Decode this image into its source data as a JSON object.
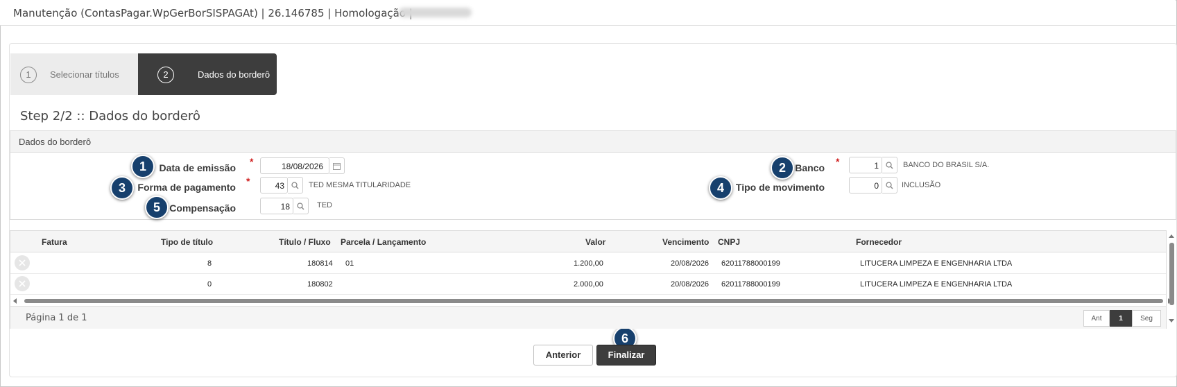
{
  "window": {
    "title": "Manutenção (ContasPagar.WpGerBorSISPAGAt) | 26.146785 | Homologação |"
  },
  "wizard": {
    "steps": [
      {
        "num": "1",
        "label": "Selecionar títulos"
      },
      {
        "num": "2",
        "label": "Dados do borderô"
      }
    ]
  },
  "step_title": "Step 2/2 :: Dados do borderô",
  "section": {
    "title": "Dados do borderô"
  },
  "form": {
    "data_emissao": {
      "label": "Data de emissão",
      "required": "*",
      "value": "18/08/2026"
    },
    "forma_pagamento": {
      "label": "Forma de pagamento",
      "required": "*",
      "value": "43",
      "desc": "TED MESMA TITULARIDADE"
    },
    "compensacao": {
      "label": "Compensação",
      "value": "18",
      "desc": "TED"
    },
    "banco": {
      "label": "Banco",
      "required": "*",
      "value": "1",
      "desc": "BANCO DO BRASIL S/A."
    },
    "tipo_movimento": {
      "label": "Tipo de movimento",
      "value": "0",
      "desc": "INCLUSÃO"
    }
  },
  "badges": [
    "1",
    "2",
    "3",
    "4",
    "5",
    "6"
  ],
  "grid": {
    "headers": [
      "Fatura",
      "Tipo de título",
      "Título / Fluxo",
      "Parcela / Lançamento",
      "Valor",
      "Vencimento",
      "CNPJ",
      "Fornecedor"
    ],
    "rows": [
      {
        "tipo": "8",
        "titulo": "180814",
        "parcela": "01",
        "valor": "1.200,00",
        "vencimento": "20/08/2026",
        "cnpj": "62011788000199",
        "fornecedor": "LITUCERA LIMPEZA E ENGENHARIA LTDA"
      },
      {
        "tipo": "0",
        "titulo": "180802",
        "parcela": "",
        "valor": "2.000,00",
        "vencimento": "20/08/2026",
        "cnpj": "62011788000199",
        "fornecedor": "LITUCERA LIMPEZA E ENGENHARIA LTDA"
      }
    ],
    "page_info": "Página 1 de 1",
    "pager": {
      "prev": "Ant",
      "current": "1",
      "next": "Seg"
    }
  },
  "buttons": {
    "anterior": "Anterior",
    "finalizar": "Finalizar"
  },
  "icons": {
    "calendar": "calendar-icon",
    "search": "search-icon",
    "remove": "remove-icon"
  },
  "colors": {
    "accent_dark": "#3d3d3d",
    "badge": "#17406d",
    "required": "#d02020"
  }
}
